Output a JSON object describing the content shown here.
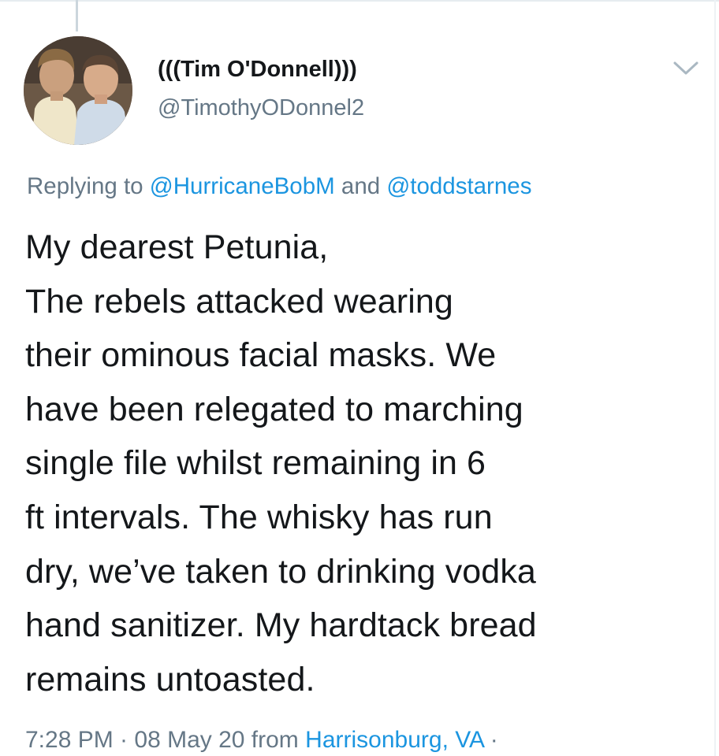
{
  "tweet": {
    "display_name": "(((Tim O'Donnell)))",
    "handle": "@TimothyODonnel2",
    "reply_context": {
      "prefix": "Replying to",
      "mention_1": "@HurricaneBobM",
      "conjunction": "and",
      "mention_2": "@toddstarnes"
    },
    "body_lines": [
      "My dearest Petunia,",
      "The rebels attacked wearing",
      "their ominous facial masks. We",
      "have been relegated to marching",
      "single file whilst remaining in 6",
      "ft intervals. The whisky has run",
      "dry, we’ve taken to drinking vodka",
      "hand sanitizer. My hardtack bread",
      "remains untoasted."
    ],
    "timestamp": "7:28 PM · 08 May 20 from",
    "location": "Harrisonburg, VA",
    "trailing_separator": "·",
    "icons": {
      "more": "chevron-down-icon"
    },
    "colors": {
      "link": "#1b95e0",
      "secondary_text": "#657786",
      "primary_text": "#14171a"
    }
  }
}
